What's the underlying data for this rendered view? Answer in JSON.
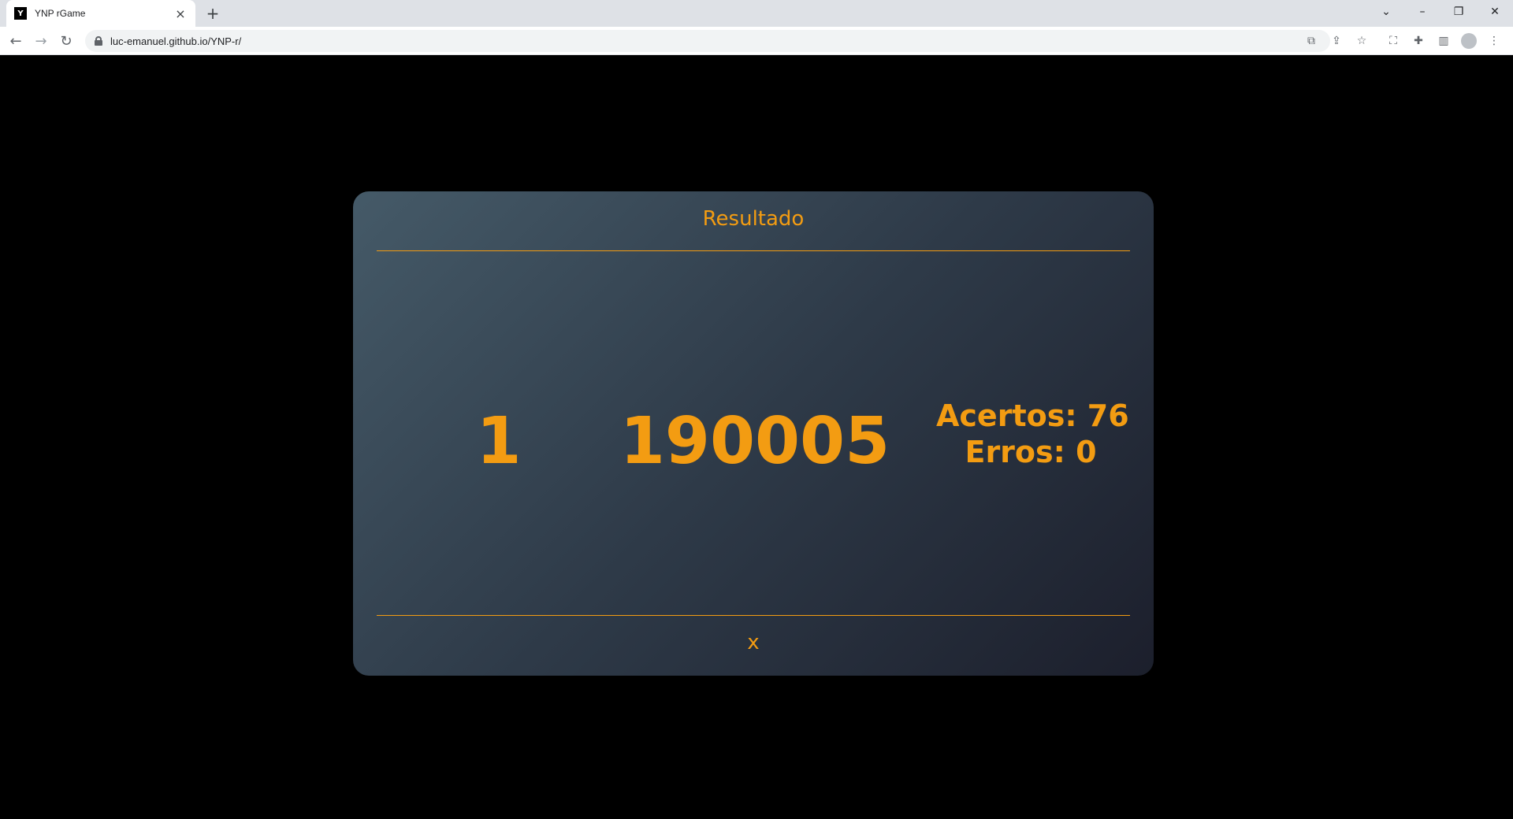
{
  "browser": {
    "tab_title": "YNP rGame",
    "favicon_text": "Y",
    "url": "luc-emanuel.github.io/YNP-r/",
    "icons": [
      "back-icon",
      "forward-icon",
      "reload-icon",
      "lock-icon",
      "translate-icon",
      "share-icon",
      "star-icon",
      "screenshot-icon",
      "extensions-icon",
      "sidepanel-icon",
      "profile-icon",
      "menu-icon"
    ]
  },
  "modal": {
    "title": "Resultado",
    "level": "1",
    "score": "190005",
    "hits": "Acertos: 76",
    "errors": "Erros: 0",
    "close_label": "x",
    "accent_color": "#f39c12"
  }
}
